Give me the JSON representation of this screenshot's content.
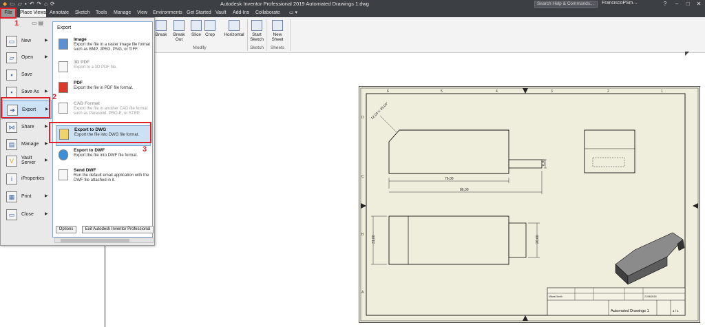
{
  "window": {
    "title": "Autodesk Inventor Professional 2019    Automated Drawings 1.dwg",
    "search_placeholder": "Search Help & Commands...",
    "user": "FranciscoPSm...",
    "help": "?",
    "minimize": "–",
    "restore": "□",
    "close": "✕"
  },
  "tabs": [
    "File",
    "Place Views",
    "Annotate",
    "Sketch",
    "Tools",
    "Manage",
    "View",
    "Environments",
    "Get Started",
    "Vault",
    "Add-Ins",
    "Collaborate"
  ],
  "ribbon": {
    "buttons": [
      "Break",
      "Break Out",
      "Slice",
      "Crop",
      "Horizontal",
      "Start Sketch",
      "New Sheet"
    ],
    "groups": [
      "Modify",
      "Sketch",
      "Sheets"
    ]
  },
  "file_menu": {
    "left_items": [
      {
        "label": "New",
        "icon": "new-icon",
        "arrow": true
      },
      {
        "label": "Open",
        "icon": "open-icon",
        "arrow": true
      },
      {
        "label": "Save",
        "icon": "save-icon",
        "arrow": false
      },
      {
        "label": "Save As",
        "icon": "save-as-icon",
        "arrow": true
      },
      {
        "label": "Export",
        "icon": "export-icon",
        "arrow": true
      },
      {
        "label": "Share",
        "icon": "share-icon",
        "arrow": true
      },
      {
        "label": "Manage",
        "icon": "manage-icon",
        "arrow": true
      },
      {
        "label": "Vault Server",
        "icon": "vault-icon",
        "arrow": true
      },
      {
        "label": "iProperties",
        "icon": "iproperties-icon",
        "arrow": false
      },
      {
        "label": "Print",
        "icon": "print-icon",
        "arrow": true
      },
      {
        "label": "Close",
        "icon": "close-doc-icon",
        "arrow": true
      }
    ],
    "panel_title": "Export",
    "export_items": [
      {
        "title": "Image",
        "desc": "Export the file in a raster image file format such as BMP, JPEG, PNG, or TIFF.",
        "enabled": true
      },
      {
        "title": "3D PDF",
        "desc": "Export to a 3D PDF file.",
        "enabled": false
      },
      {
        "title": "PDF",
        "desc": "Export the file in PDF file format.",
        "enabled": true
      },
      {
        "title": "CAD Format",
        "desc": "Export the file in another CAD file format such as Parasolid, PRO-E, or STEP.",
        "enabled": false
      },
      {
        "title": "Export to DWG",
        "desc": "Export the file into DWG file format.",
        "enabled": true
      },
      {
        "title": "Export to DWF",
        "desc": "Export the file into DWF file format.",
        "enabled": true
      },
      {
        "title": "Send DWF",
        "desc": "Run the default email application with the DWF file attached in it.",
        "enabled": true
      }
    ],
    "options_label": "Options",
    "exit_label": "Exit Autodesk Inventor Professional"
  },
  "callouts": [
    "1",
    "2",
    "3"
  ],
  "drawing": {
    "chamfer_label": "12,00 X 45,00°",
    "dim_76": "76,00",
    "dim_86": "86,00",
    "dim_6": "6,00",
    "dim_31": "31,00",
    "dim_20": "20,00",
    "title_block": "Automated Drawings 1",
    "sheet_no": "1 / 1",
    "author": "Mikeal Smith",
    "date": "21/08/2018",
    "cols": [
      "6",
      "5",
      "4",
      "3",
      "2",
      "1"
    ],
    "rows": [
      "D",
      "C",
      "B",
      "A"
    ]
  }
}
